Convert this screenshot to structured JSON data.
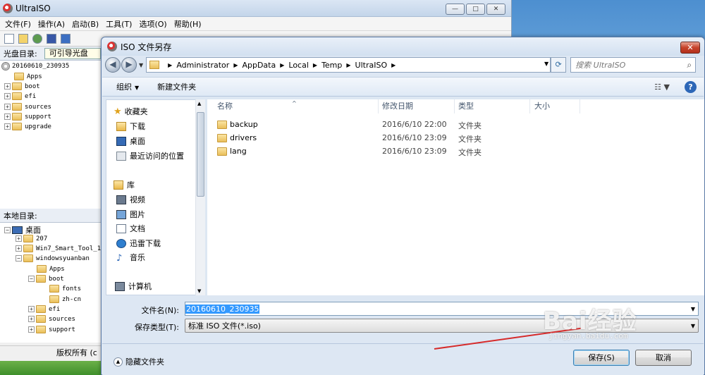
{
  "ultraiso": {
    "title": "UltraISO",
    "menu": [
      "文件(F)",
      "操作(A)",
      "启动(B)",
      "工具(T)",
      "选项(O)",
      "帮助(H)"
    ],
    "cd_dir_label": "光盘目录:",
    "cd_dir_value": "可引导光盘",
    "cd_tree": [
      "20160610_230935",
      "Apps",
      "boot",
      "efi",
      "sources",
      "support",
      "upgrade"
    ],
    "local_dir_label": "本地目录:",
    "local_tree": [
      "桌面",
      "207",
      "Win7_Smart_Tool_1",
      "windowsyuanban",
      "Apps",
      "boot",
      "fonts",
      "zh-cn",
      "efi",
      "sources",
      "support"
    ],
    "status": "版权所有 (c"
  },
  "dialog": {
    "title": "ISO 文件另存",
    "close": "✕",
    "breadcrumb": [
      "Administrator",
      "AppData",
      "Local",
      "Temp",
      "UltraISO"
    ],
    "search_placeholder": "搜索 UltraISO",
    "organize": "组织",
    "new_folder": "新建文件夹",
    "help": "?",
    "nav": {
      "favorites": "收藏夹",
      "downloads": "下载",
      "desktop": "桌面",
      "recent": "最近访问的位置",
      "libraries": "库",
      "videos": "视频",
      "pictures": "图片",
      "documents": "文档",
      "thunder": "迅雷下载",
      "music": "音乐",
      "computer": "计算机"
    },
    "columns": {
      "name": "名称",
      "modified": "修改日期",
      "type": "类型",
      "size": "大小"
    },
    "files": [
      {
        "name": "backup",
        "modified": "2016/6/10 22:00",
        "type": "文件夹"
      },
      {
        "name": "drivers",
        "modified": "2016/6/10 23:09",
        "type": "文件夹"
      },
      {
        "name": "lang",
        "modified": "2016/6/10 23:09",
        "type": "文件夹"
      }
    ],
    "filename_label": "文件名(N):",
    "filename_value": "20160610_230935",
    "filetype_label": "保存类型(T):",
    "filetype_value": "标准 ISO 文件(*.iso)",
    "hide_folders": "隐藏文件夹",
    "save": "保存(S)",
    "cancel": "取消"
  },
  "watermark": {
    "brand": "Bai经验",
    "url": "jingyan.baidu.com"
  },
  "colors": {
    "accent": "#3399ff",
    "dialog_bg": "#dde7f3",
    "annotation": "#d62a2a"
  }
}
